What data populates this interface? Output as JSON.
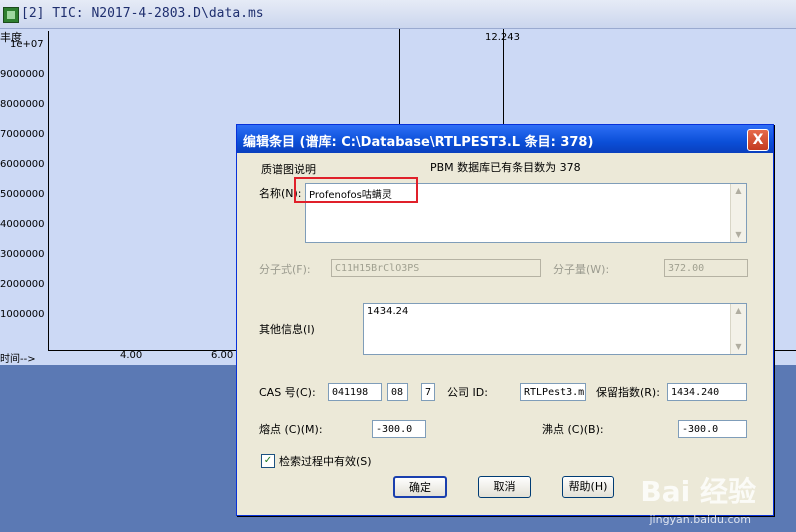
{
  "tic_window": {
    "title": "[2] TIC: N2017-4-2803.D\\data.ms",
    "y_unit": "丰度",
    "y_exponent": "1e+07",
    "y_ticks": [
      "9000000",
      "8000000",
      "7000000",
      "6000000",
      "5000000",
      "4000000",
      "3000000",
      "2000000",
      "1000000"
    ],
    "x_label": "时间-->",
    "x_ticks": [
      "4.00",
      "6.00"
    ],
    "peak_label": "12.243"
  },
  "dialog": {
    "title": "编辑条目 (谱库: C:\\Database\\RTLPEST3.L 条目: 378)",
    "close": "X",
    "spectrum_label": "质谱图说明",
    "db_count_text": "PBM 数据库已有条目数为 378",
    "name_label": "名称(N):",
    "name_value": "Profenofos咕螨灵",
    "formula_label": "分子式(F):",
    "formula_value": "C11H15BrClO3PS",
    "mw_label": "分子量(W):",
    "mw_value": "372.00",
    "other_label": "其他信息(I)",
    "other_value": "1434.24",
    "cas_label": "CAS 号(C):",
    "cas_part1": "041198",
    "cas_part2": "08",
    "cas_part3": "7",
    "company_label": "公司 ID:",
    "company_value": "RTLPest3.m",
    "ri_label": "保留指数(R):",
    "ri_value": "1434.240",
    "mp_label": "熔点 (C)(M):",
    "mp_value": "-300.0",
    "bp_label": "沸点 (C)(B):",
    "bp_value": "-300.0",
    "search_checkbox": "检索过程中有效(S)",
    "ok_button": "确定",
    "cancel_button": "取消",
    "help_button": "帮助(H)"
  },
  "watermark": {
    "text": "Bai 经验",
    "sub": "jingyan.baidu.com"
  }
}
